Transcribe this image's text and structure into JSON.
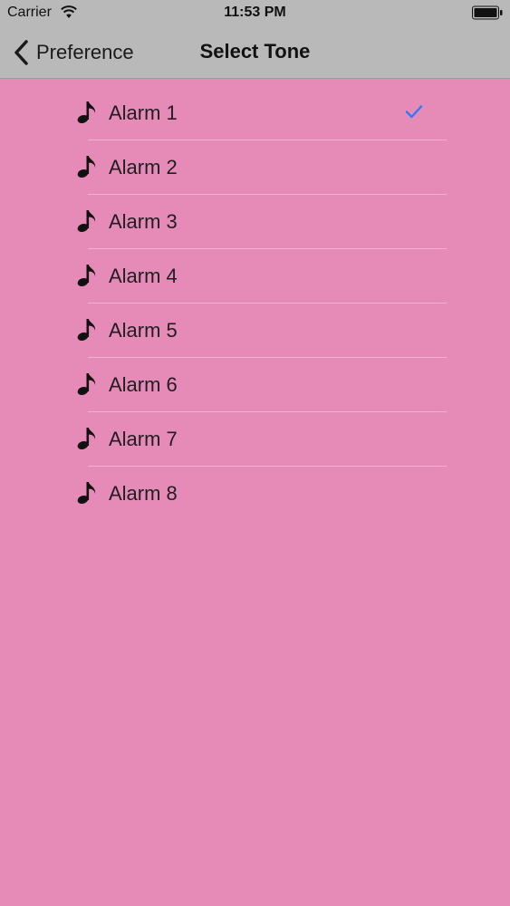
{
  "status_bar": {
    "carrier": "Carrier",
    "time": "11:53 PM",
    "icons": [
      "wifi-icon",
      "battery-icon"
    ]
  },
  "nav": {
    "back_label": "Preference",
    "title": "Select Tone",
    "back_icon": "chevron-left-icon"
  },
  "tones": {
    "row_icon": "music-note-icon",
    "selected_icon": "checkmark-icon",
    "selected_color": "#2F7BF5",
    "items": [
      {
        "label": "Alarm 1",
        "selected": true
      },
      {
        "label": "Alarm 2",
        "selected": false
      },
      {
        "label": "Alarm 3",
        "selected": false
      },
      {
        "label": "Alarm 4",
        "selected": false
      },
      {
        "label": "Alarm 5",
        "selected": false
      },
      {
        "label": "Alarm 6",
        "selected": false
      },
      {
        "label": "Alarm 7",
        "selected": false
      },
      {
        "label": "Alarm 8",
        "selected": false
      }
    ]
  },
  "colors": {
    "background": "#E68AB8",
    "bars": "#B9B9B9"
  }
}
